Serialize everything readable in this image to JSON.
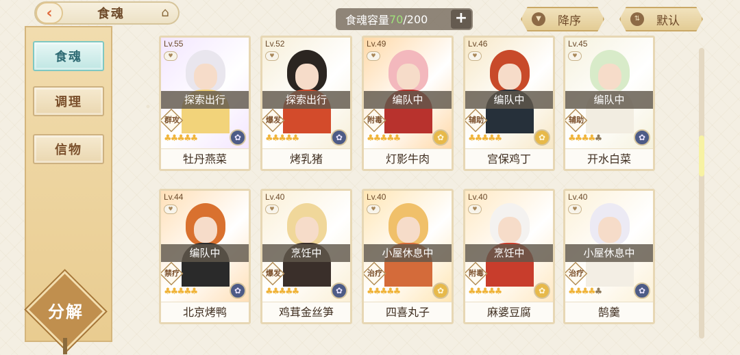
{
  "header": {
    "back_icon": "back-arrow-icon",
    "title": "食魂",
    "home_icon": "house-icon",
    "capacity_label": "食魂容量",
    "capacity_current": "70",
    "capacity_total": "/200",
    "capacity_add": "+",
    "sort_desc_label": "降序",
    "sort_default_label": "默认"
  },
  "sidebar": {
    "tabs": [
      "食魂",
      "调理",
      "信物"
    ],
    "active": 0,
    "decompose_label": "分解"
  },
  "cards": [
    {
      "lv": "Lv.55",
      "status": "探索出行",
      "role": "群攻",
      "stars": 5,
      "name": "牡丹燕菜",
      "hair": "#e9e6ee",
      "body": "#f2d37a",
      "bg": "#f3e6ff",
      "emblem": "blue"
    },
    {
      "lv": "Lv.52",
      "status": "探索出行",
      "role": "爆发",
      "stars": 5,
      "name": "烤乳猪",
      "hair": "#2b2521",
      "body": "#d34b2b",
      "bg": "#f7efd9",
      "emblem": "blue"
    },
    {
      "lv": "Lv.49",
      "status": "编队中",
      "role": "附毒",
      "stars": 5,
      "name": "灯影牛肉",
      "hair": "#f3b8bd",
      "body": "#b8322d",
      "bg": "#ffd9a8",
      "emblem": "gold"
    },
    {
      "lv": "Lv.46",
      "status": "编队中",
      "role": "辅助",
      "stars": 5,
      "name": "宫保鸡丁",
      "hair": "#c84a2a",
      "body": "#26303a",
      "bg": "#f7e8c7",
      "emblem": "gold"
    },
    {
      "lv": "Lv.45",
      "status": "编队中",
      "role": "辅助",
      "stars": 4,
      "name": "开水白菜",
      "hair": "#d8ebc9",
      "body": "#f2ede1",
      "bg": "#f6f2de",
      "emblem": "blue"
    },
    {
      "lv": "Lv.44",
      "status": "编队中",
      "role": "禁疗",
      "stars": 5,
      "name": "北京烤鸭",
      "hair": "#d9712f",
      "body": "#2a2a2a",
      "bg": "#ffe0b8",
      "emblem": "blue"
    },
    {
      "lv": "Lv.40",
      "status": "烹饪中",
      "role": "爆发",
      "stars": 5,
      "name": "鸡茸金丝笋",
      "hair": "#f0d79a",
      "body": "#3a2f2a",
      "bg": "#fbf0d7",
      "emblem": "blue"
    },
    {
      "lv": "Lv.40",
      "status": "小屋休息中",
      "role": "治疗",
      "stars": 5,
      "name": "四喜丸子",
      "hair": "#f0c06a",
      "body": "#d46b3a",
      "bg": "#ffe6b5",
      "emblem": "gold"
    },
    {
      "lv": "Lv.40",
      "status": "烹饪中",
      "role": "附毒",
      "stars": 5,
      "name": "麻婆豆腐",
      "hair": "#f4f2f0",
      "body": "#c83d2c",
      "bg": "#ffe9c4",
      "emblem": "gold"
    },
    {
      "lv": "Lv.40",
      "status": "小屋休息中",
      "role": "治疗",
      "stars": 4,
      "name": "鹄羹",
      "hair": "#eceaf4",
      "body": "#f3eee4",
      "bg": "#fcf1d8",
      "emblem": "blue"
    }
  ]
}
